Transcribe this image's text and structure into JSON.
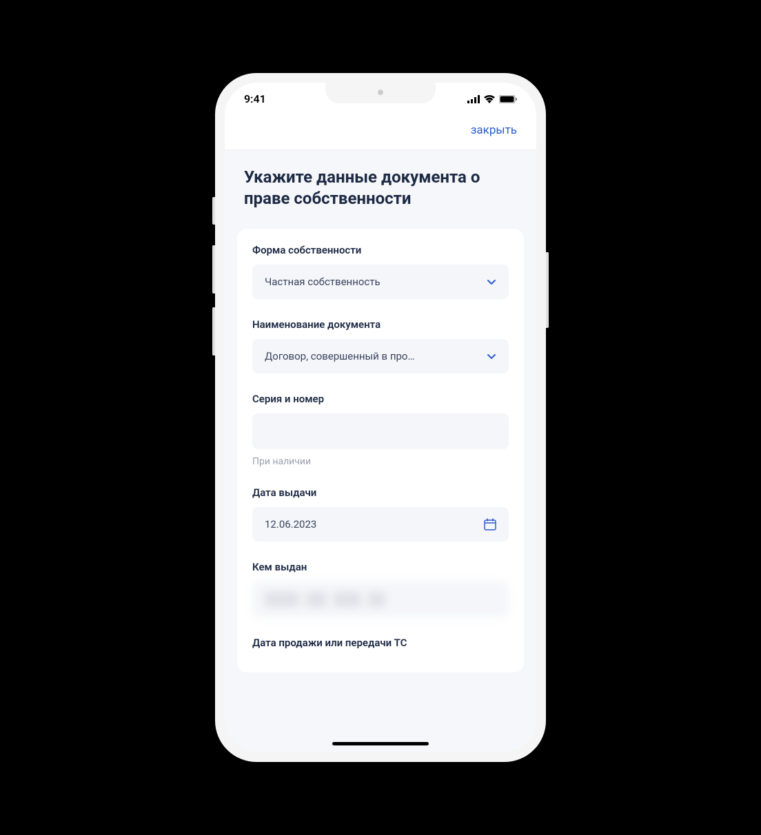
{
  "status_bar": {
    "time": "9:41"
  },
  "header": {
    "close_label": "закрыть"
  },
  "page": {
    "title": "Укажите данные документа о праве собственности"
  },
  "form": {
    "ownership_type": {
      "label": "Форма собственности",
      "value": "Частная собственность"
    },
    "document_name": {
      "label": "Наименование документа",
      "value": "Договор, совершенный в про…"
    },
    "series_number": {
      "label": "Серия и номер",
      "value": "",
      "hint": "При наличии"
    },
    "issue_date": {
      "label": "Дата выдачи",
      "value": "12.06.2023"
    },
    "issued_by": {
      "label": "Кем выдан",
      "value": ""
    },
    "sale_date": {
      "label": "Дата продажи или передачи ТС"
    }
  }
}
